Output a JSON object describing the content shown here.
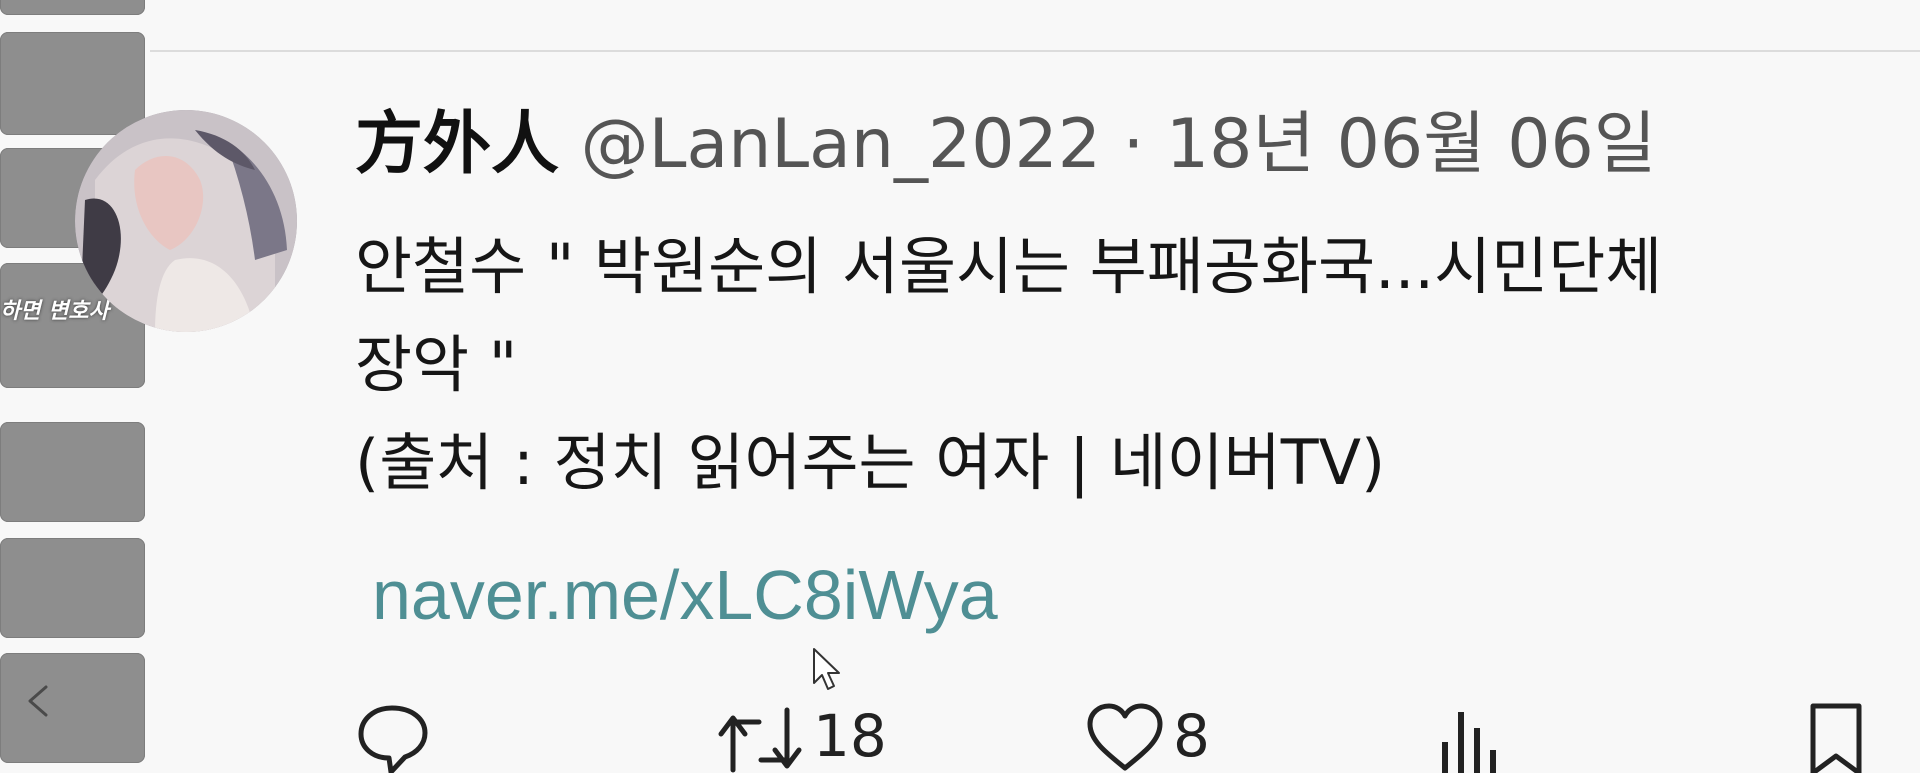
{
  "sidebar": {
    "thumb_label": "하면 변호사",
    "prev_icon": "chevron-left-icon"
  },
  "tweet": {
    "display_name": "方外人",
    "handle": "@LanLan_2022",
    "separator": "·",
    "date": "18년 06월 06일",
    "body_lines": [
      "안철수 \" 박원순의 서울시는 부패공화국...시민단체",
      "장악 \"",
      "(출처 : 정치 읽어주는 여자 | 네이버TV)"
    ],
    "link": "naver.me/xLC8iWya"
  },
  "actions": {
    "reply_icon": "reply-icon",
    "retweet_icon": "retweet-icon",
    "retweet_count": "18",
    "like_icon": "heart-icon",
    "like_count": "8",
    "views_icon": "bar-chart-icon",
    "bookmark_icon": "bookmark-icon"
  },
  "colors": {
    "link": "#4f8f94",
    "thumb": "#8e8e8e"
  }
}
